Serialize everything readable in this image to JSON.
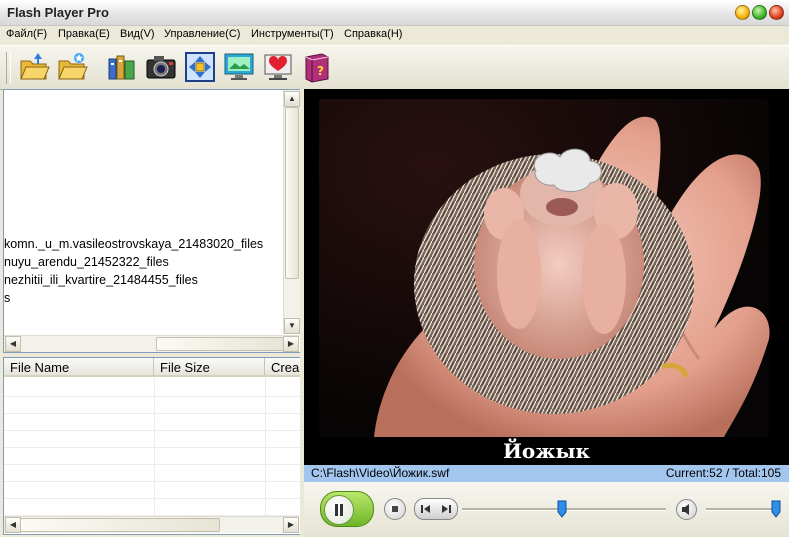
{
  "window": {
    "title": "Flash Player Pro"
  },
  "menu": [
    "Файл(F)",
    "Правка(E)",
    "Вид(V)",
    "Управление(C)",
    "Инструменты(T)",
    "Справка(H)"
  ],
  "toolbar": [
    "open-file-icon",
    "open-folder-icon",
    "library-icon",
    "camera-icon",
    "fullscreen-icon",
    "screen-icon",
    "favorites-icon",
    "help-book-icon"
  ],
  "tree": {
    "items": [
      "komn._u_m.vasileostrovskaya_21483020_files",
      "nuyu_arendu_21452322_files",
      "nezhitii_ili_kvartire_21484455_files",
      "s"
    ]
  },
  "filelist": {
    "columns": [
      "File Name",
      "File Size",
      "Crea"
    ]
  },
  "video": {
    "caption": "Йожык"
  },
  "status": {
    "path": "C:\\Flash\\Video\\Йожик.swf",
    "frames": "Current:52 / Total:105"
  },
  "player": {
    "progress": 0.49,
    "volume": 0.97
  },
  "colors": {
    "status_bar": "#a3c6ef",
    "play_button": "#8bc34a",
    "slider_thumb": "#2f8fe8"
  }
}
